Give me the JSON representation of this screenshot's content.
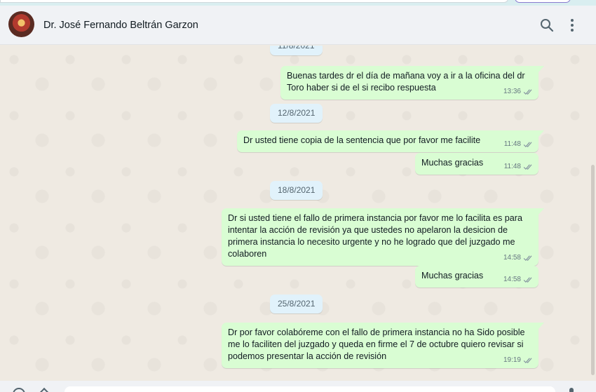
{
  "header": {
    "contact_name": "Dr. José Fernando Beltrán Garzon",
    "search_icon": "search-icon",
    "menu_icon": "kebab-menu-icon"
  },
  "colors": {
    "chat_background": "#efeae2",
    "outgoing_bubble": "#d9fdd3",
    "date_chip": "#e1f2fb",
    "header_background": "#f0f2f5"
  },
  "dates": [
    "11/8/2021",
    "12/8/2021",
    "18/8/2021",
    "25/8/2021"
  ],
  "messages": [
    {
      "text": "Buenas tardes dr el día de mañana voy a ir a la oficina del dr Toro haber si de el si recibo respuesta",
      "time": "13:36",
      "status": "read-double-check-icon"
    },
    {
      "text": "Dr usted tiene copia de la sentencia que por favor me facilite",
      "time": "11:48",
      "status": "read-double-check-icon"
    },
    {
      "text": "Muchas gracias",
      "time": "11:48",
      "status": "read-double-check-icon"
    },
    {
      "text": "Dr si usted tiene el fallo de primera instancia por favor me lo facilita es para intentar la acción de revisión ya que ustedes no apelaron la desicion de primera instancia lo necesito urgente y no he logrado que del juzgado me colaboren",
      "time": "14:58",
      "status": "read-double-check-icon"
    },
    {
      "text": "Muchas gracias",
      "time": "14:58",
      "status": "read-double-check-icon"
    },
    {
      "text": "Dr por favor colabóreme con el fallo de primera instancia no ha Sido posible me lo faciliten del juzgado y queda en firme el 7 de octubre quiero revisar si podemos presentar la acción de revisión",
      "time": "19:19",
      "status": "read-double-check-icon"
    }
  ]
}
